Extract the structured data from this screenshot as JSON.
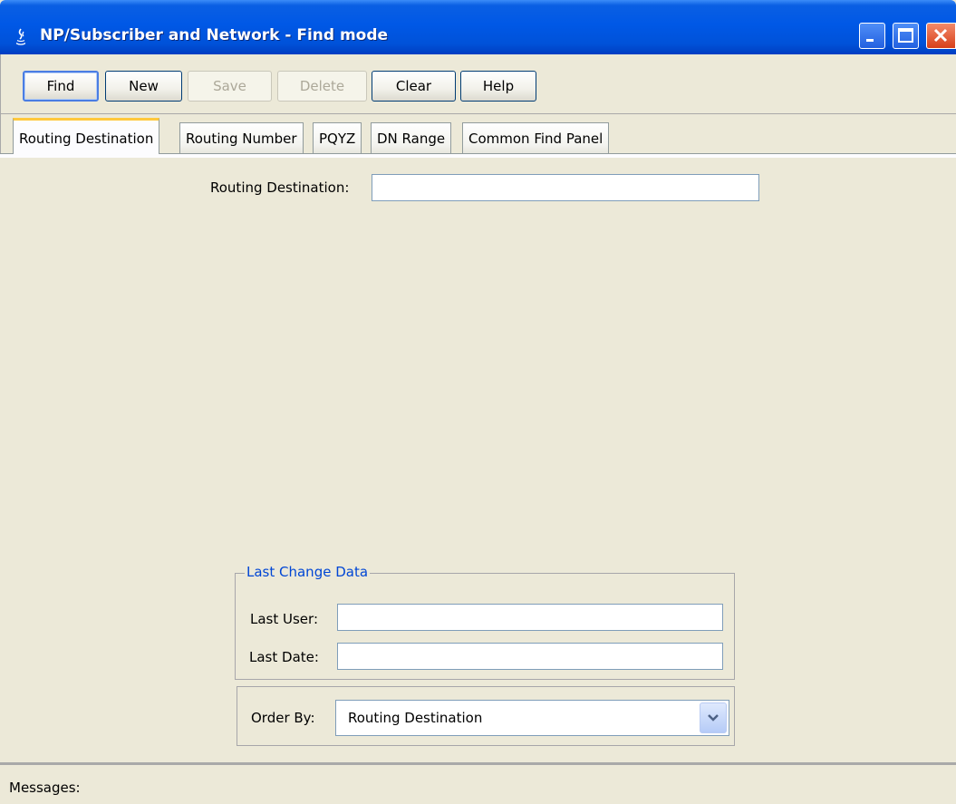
{
  "window": {
    "title": "NP/Subscriber and Network  -  Find mode",
    "controls": [
      "minimize-icon",
      "maximize-icon",
      "close-icon"
    ]
  },
  "toolbar": {
    "find": "Find",
    "new": "New",
    "save": "Save",
    "delete": "Delete",
    "clear": "Clear",
    "help": "Help"
  },
  "tabs": [
    {
      "label": "Routing Destination",
      "active": true
    },
    {
      "label": "Routing Number",
      "active": false
    },
    {
      "label": "PQYZ",
      "active": false
    },
    {
      "label": "DN Range",
      "active": false
    },
    {
      "label": "Common Find Panel",
      "active": false
    }
  ],
  "form": {
    "routing_destination_label": "Routing Destination:",
    "routing_destination_value": ""
  },
  "last_change": {
    "title": "Last Change Data",
    "last_user_label": "Last User:",
    "last_user_value": "",
    "last_date_label": "Last Date:",
    "last_date_value": ""
  },
  "order_by": {
    "label": "Order By:",
    "selected": "Routing Destination"
  },
  "messages": {
    "label": "Messages:"
  },
  "colors": {
    "titlebar": "#0058e6",
    "window_bg": "#ece9d8",
    "group_title": "#0046d5",
    "active_tab_accent": "#ffc83c"
  }
}
